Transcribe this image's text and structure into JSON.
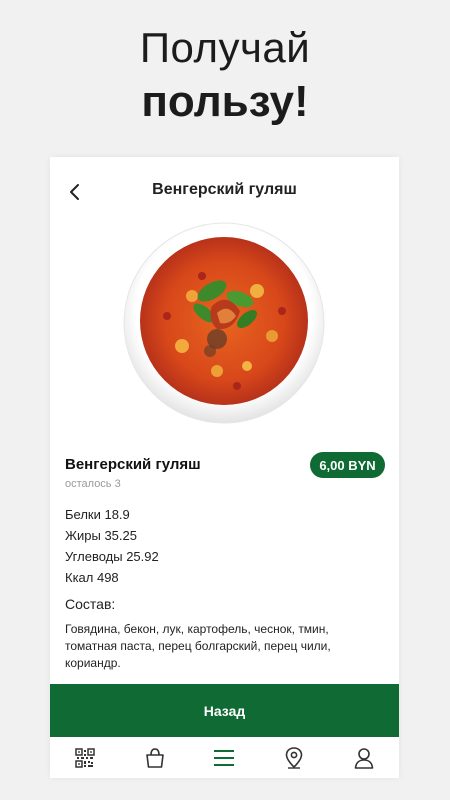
{
  "promo": {
    "line1": "Получай",
    "line2": "пользу!"
  },
  "header": {
    "title": "Венгерский гуляш",
    "back_icon": "chevron-left-icon"
  },
  "product": {
    "name": "Венгерский гуляш",
    "remaining": "осталось 3",
    "price": "6,00 BYN",
    "nutrition": [
      "Белки 18.9",
      "Жиры 35.25",
      "Углеводы 25.92",
      "Ккал 498"
    ],
    "composition_title": "Состав:",
    "composition_text": "Говядина, бекон, лук, картофель, чеснок, тмин, томатная паста, перец болгарский, перец чили, кориандр."
  },
  "actions": {
    "back_label": "Назад"
  },
  "tabbar": {
    "items": [
      {
        "icon": "qr-code-icon"
      },
      {
        "icon": "shopping-bag-icon"
      },
      {
        "icon": "menu-icon",
        "active": true
      },
      {
        "icon": "map-pin-icon"
      },
      {
        "icon": "user-icon"
      }
    ]
  },
  "colors": {
    "brand_green": "#0f6b33",
    "background": "#f1f1f1"
  }
}
